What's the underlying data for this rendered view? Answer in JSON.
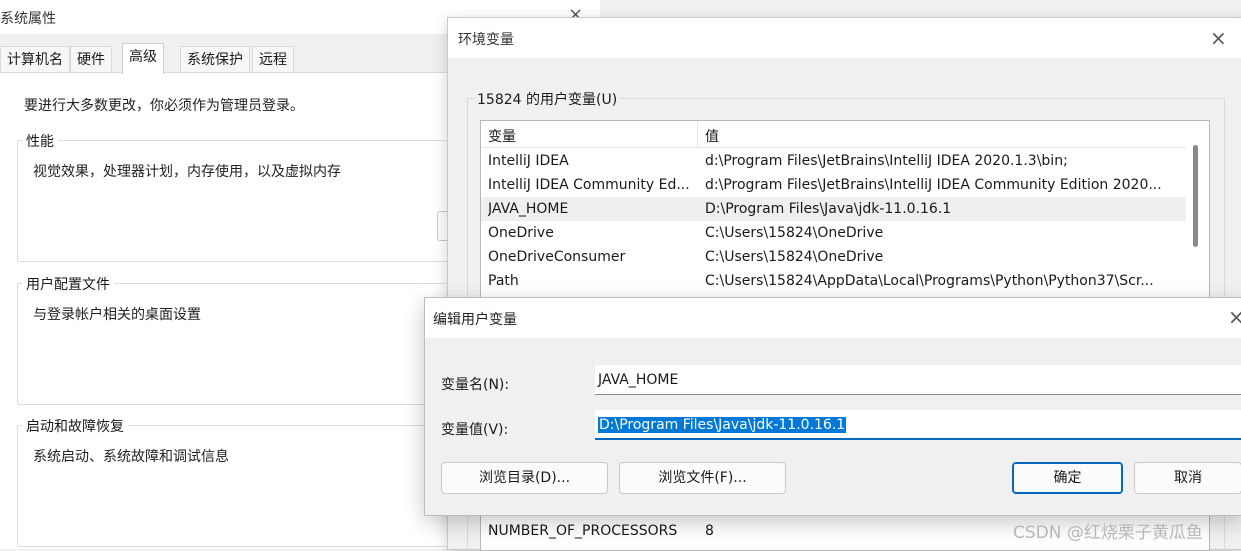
{
  "system_properties": {
    "title": "系统属性",
    "close_glyph": "×",
    "tabs": [
      {
        "label": "计算机名"
      },
      {
        "label": "硬件"
      },
      {
        "label": "高级"
      },
      {
        "label": "系统保护"
      },
      {
        "label": "远程"
      }
    ],
    "admin_notice": "要进行大多数更改，你必须作为管理员登录。",
    "groups": [
      {
        "title": "性能",
        "desc": "视觉效果，处理器计划，内存使用，以及虚拟内存"
      },
      {
        "title": "用户配置文件",
        "desc": "与登录帐户相关的桌面设置"
      },
      {
        "title": "启动和故障恢复",
        "desc": "系统启动、系统故障和调试信息"
      }
    ]
  },
  "env_window": {
    "title": "环境变量",
    "close_glyph": "×",
    "user_vars_group": "15824 的用户变量(U)",
    "columns": {
      "name": "变量",
      "value": "值"
    },
    "rows": [
      {
        "name": "IntelliJ IDEA",
        "value": "d:\\Program Files\\JetBrains\\IntelliJ IDEA 2020.1.3\\bin;"
      },
      {
        "name": "IntelliJ IDEA Community Ed...",
        "value": "d:\\Program Files\\JetBrains\\IntelliJ IDEA Community Edition 2020..."
      },
      {
        "name": "JAVA_HOME",
        "value": "D:\\Program Files\\Java\\jdk-11.0.16.1"
      },
      {
        "name": "OneDrive",
        "value": "C:\\Users\\15824\\OneDrive"
      },
      {
        "name": "OneDriveConsumer",
        "value": "C:\\Users\\15824\\OneDrive"
      },
      {
        "name": "Path",
        "value": "C:\\Users\\15824\\AppData\\Local\\Programs\\Python\\Python37\\Scr..."
      }
    ],
    "system_row": {
      "name": "NUMBER_OF_PROCESSORS",
      "value": "8"
    }
  },
  "edit_dialog": {
    "title": "编辑用户变量",
    "close_glyph": "×",
    "name_label": "变量名(N):",
    "name_value": "JAVA_HOME",
    "value_label": "变量值(V):",
    "value_value": "D:\\Program Files\\Java\\jdk-11.0.16.1",
    "buttons": {
      "browse_dir": "浏览目录(D)...",
      "browse_file": "浏览文件(F)...",
      "ok": "确定",
      "cancel": "取消"
    }
  },
  "watermark": "CSDN @红烧栗子黄瓜鱼",
  "colors": {
    "accent": "#0078d7",
    "focus_border": "#0067c0"
  }
}
